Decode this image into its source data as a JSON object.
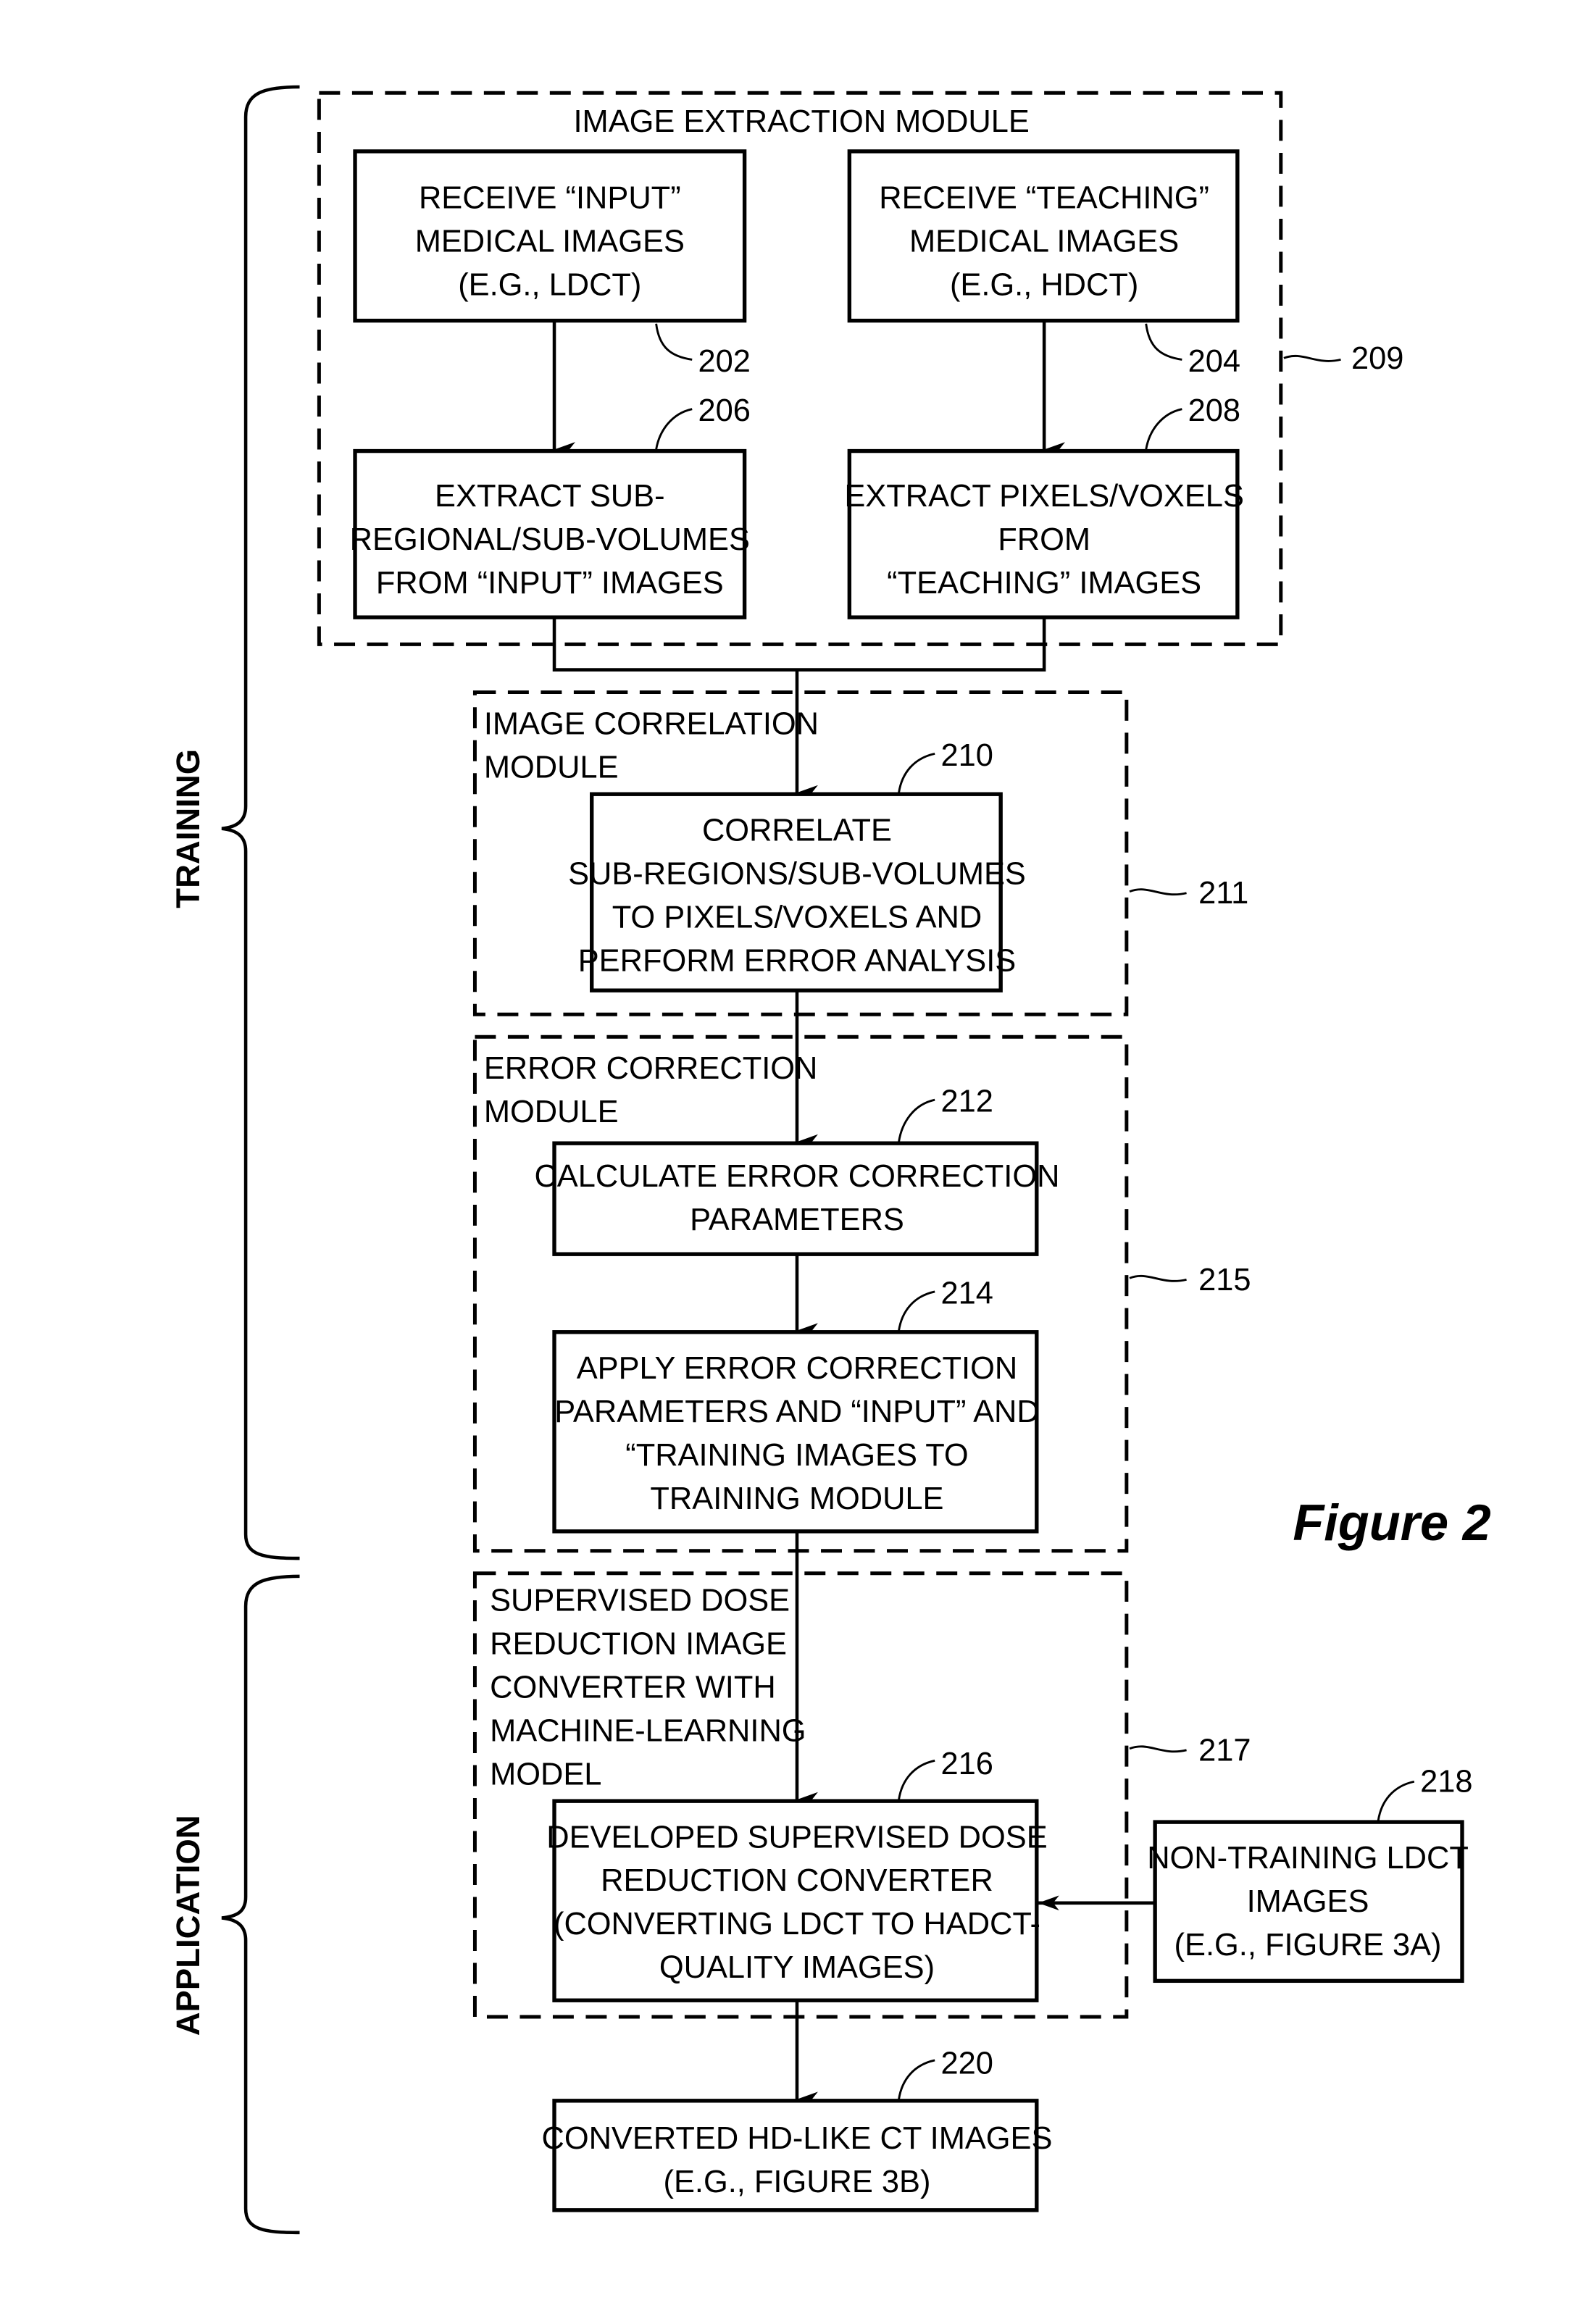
{
  "figure_label": "Figure 2",
  "sections": {
    "training": "TRAINING",
    "application": "APPLICATION"
  },
  "modules": {
    "m209": {
      "ref": "209",
      "title_lines": [
        "IMAGE EXTRACTION MODULE"
      ]
    },
    "m211": {
      "ref": "211",
      "title_lines": [
        "IMAGE CORRELATION",
        "MODULE"
      ]
    },
    "m215": {
      "ref": "215",
      "title_lines": [
        "ERROR CORRECTION",
        "MODULE"
      ]
    },
    "m217": {
      "ref": "217",
      "title_lines": [
        "SUPERVISED DOSE",
        "REDUCTION IMAGE",
        "CONVERTER WITH",
        "MACHINE-LEARNING",
        "MODEL"
      ]
    }
  },
  "steps": {
    "s202": {
      "ref": "202",
      "lines": [
        "RECEIVE “INPUT”",
        "MEDICAL IMAGES",
        "(E.G., LDCT)"
      ]
    },
    "s204": {
      "ref": "204",
      "lines": [
        "RECEIVE “TEACHING”",
        "MEDICAL IMAGES",
        "(E.G., HDCT)"
      ]
    },
    "s206": {
      "ref": "206",
      "lines": [
        "EXTRACT SUB-",
        "REGIONAL/SUB-VOLUMES",
        "FROM “INPUT” IMAGES"
      ]
    },
    "s208": {
      "ref": "208",
      "lines": [
        "EXTRACT PIXELS/VOXELS",
        "FROM",
        "“TEACHING” IMAGES"
      ]
    },
    "s210": {
      "ref": "210",
      "lines": [
        "CORRELATE",
        "SUB-REGIONS/SUB-VOLUMES",
        "TO PIXELS/VOXELS AND",
        "PERFORM ERROR ANALYSIS"
      ]
    },
    "s212": {
      "ref": "212",
      "lines": [
        "CALCULATE ERROR CORRECTION",
        "PARAMETERS"
      ]
    },
    "s214": {
      "ref": "214",
      "lines": [
        "APPLY ERROR CORRECTION",
        "PARAMETERS AND “INPUT” AND",
        "“TRAINING IMAGES TO",
        "TRAINING MODULE"
      ]
    },
    "s216": {
      "ref": "216",
      "lines": [
        "DEVELOPED SUPERVISED DOSE",
        "REDUCTION CONVERTER",
        "(CONVERTING LDCT TO HADCT-",
        "QUALITY IMAGES)"
      ]
    },
    "s218": {
      "ref": "218",
      "lines": [
        "NON-TRAINING LDCT",
        "IMAGES",
        "(E.G., FIGURE 3A)"
      ]
    },
    "s220": {
      "ref": "220",
      "lines": [
        "CONVERTED HD-LIKE CT IMAGES",
        "(E.G., FIGURE 3B)"
      ]
    }
  }
}
